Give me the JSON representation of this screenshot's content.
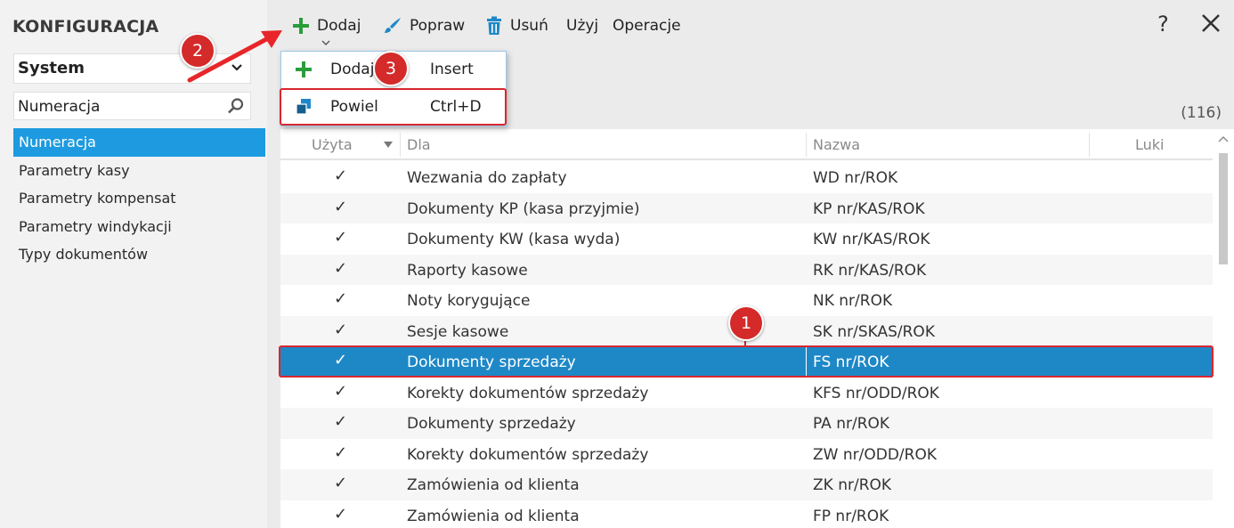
{
  "sidebar": {
    "app_title": "KONFIGURACJA",
    "module": "System",
    "search_value": "Numeracja",
    "items": [
      {
        "label": "Numeracja",
        "active": true
      },
      {
        "label": "Parametry kasy"
      },
      {
        "label": "Parametry kompensat"
      },
      {
        "label": "Parametry windykacji"
      },
      {
        "label": "Typy dokumentów"
      }
    ]
  },
  "toolbar": {
    "dodaj": "Dodaj",
    "popraw": "Popraw",
    "usun": "Usuń",
    "uzyj": "Użyj",
    "operacje": "Operacje",
    "help": "?"
  },
  "dropdown": {
    "items": [
      {
        "label": "Dodaj",
        "shortcut": "Insert",
        "icon": "plus-icon"
      },
      {
        "label": "Powiel",
        "shortcut": "Ctrl+D",
        "icon": "duplicate-icon"
      }
    ]
  },
  "record_count": "(116)",
  "table": {
    "headers": {
      "uzyta": "Użyta",
      "dla": "Dla",
      "nazwa": "Nazwa",
      "luki": "Luki"
    },
    "rows": [
      {
        "check": "✓",
        "dla": "Wezwania do zapłaty",
        "nazwa": "WD nr/ROK"
      },
      {
        "check": "✓",
        "dla": "Dokumenty KP (kasa przyjmie)",
        "nazwa": "KP nr/KAS/ROK"
      },
      {
        "check": "✓",
        "dla": "Dokumenty KW (kasa wyda)",
        "nazwa": "KW nr/KAS/ROK"
      },
      {
        "check": "✓",
        "dla": "Raporty kasowe",
        "nazwa": "RK nr/KAS/ROK"
      },
      {
        "check": "✓",
        "dla": "Noty korygujące",
        "nazwa": "NK nr/ROK"
      },
      {
        "check": "✓",
        "dla": "Sesje kasowe",
        "nazwa": "SK nr/SKAS/ROK"
      },
      {
        "check": "✓",
        "dla": "Dokumenty sprzedaży",
        "nazwa": "FS nr/ROK",
        "selected": true
      },
      {
        "check": "✓",
        "dla": "Korekty dokumentów sprzedaży",
        "nazwa": "KFS nr/ODD/ROK"
      },
      {
        "check": "✓",
        "dla": "Dokumenty sprzedaży",
        "nazwa": "PA nr/ROK"
      },
      {
        "check": "✓",
        "dla": "Korekty dokumentów sprzedaży",
        "nazwa": "ZW nr/ODD/ROK"
      },
      {
        "check": "✓",
        "dla": "Zamówienia od klienta",
        "nazwa": "ZK nr/ROK"
      },
      {
        "check": "✓",
        "dla": "Zamówienia od klienta",
        "nazwa": "FP nr/ROK"
      }
    ]
  },
  "callouts": {
    "one": "1",
    "two": "2",
    "three": "3"
  },
  "colors": {
    "accent": "#1e9be0",
    "selected_row": "#1e88c7",
    "callout": "#d42a2a",
    "plus_green": "#2a9d3a"
  }
}
